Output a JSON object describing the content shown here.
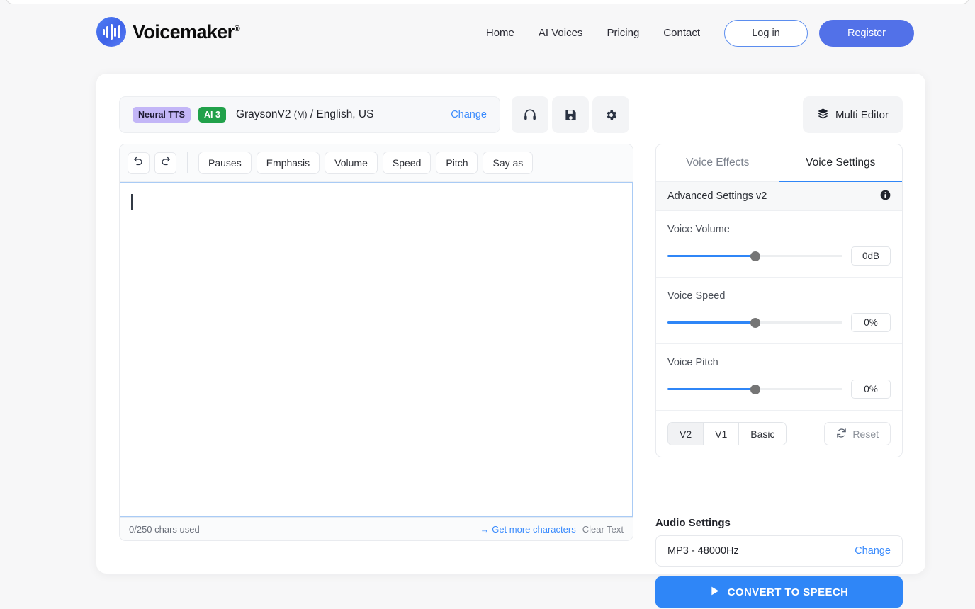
{
  "brand": {
    "name": "Voicemaker",
    "registered": "®",
    "logo_icon": "soundwave-icon"
  },
  "nav": {
    "items": [
      {
        "label": "Home"
      },
      {
        "label": "AI Voices"
      },
      {
        "label": "Pricing"
      },
      {
        "label": "Contact"
      }
    ],
    "login_label": "Log in",
    "register_label": "Register"
  },
  "voice_bar": {
    "badge_engine": "Neural TTS",
    "badge_ai": "AI 3",
    "voice_name": "GraysonV2",
    "voice_gender": "(M)",
    "voice_locale": "/ English, US",
    "change_label": "Change",
    "icons": [
      "headphones-icon",
      "save-icon",
      "gear-icon"
    ],
    "multi_editor_label": "Multi Editor",
    "multi_editor_icon": "layers-icon"
  },
  "editor": {
    "undo_icon": "undo-icon",
    "redo_icon": "redo-icon",
    "tools": [
      {
        "label": "Pauses"
      },
      {
        "label": "Emphasis"
      },
      {
        "label": "Volume"
      },
      {
        "label": "Speed"
      },
      {
        "label": "Pitch"
      },
      {
        "label": "Say as"
      }
    ],
    "text_value": "",
    "char_count": "0/250 chars used",
    "get_more_label": "Get more characters",
    "get_more_arrow": "→",
    "clear_text_label": "Clear Text"
  },
  "panel": {
    "tabs": [
      {
        "label": "Voice Effects",
        "active": false
      },
      {
        "label": "Voice Settings",
        "active": true
      }
    ],
    "advanced_label": "Advanced Settings v2",
    "info_icon": "info-icon",
    "sliders": [
      {
        "label": "Voice Volume",
        "value": "0dB",
        "percent": 50
      },
      {
        "label": "Voice Speed",
        "value": "0%",
        "percent": 50
      },
      {
        "label": "Voice Pitch",
        "value": "0%",
        "percent": 50
      }
    ],
    "segments": [
      {
        "label": "V2",
        "active": true
      },
      {
        "label": "V1",
        "active": false
      },
      {
        "label": "Basic",
        "active": false
      }
    ],
    "reset_label": "Reset",
    "reset_icon": "refresh-icon"
  },
  "audio": {
    "title": "Audio Settings",
    "format": "MP3 - 48000Hz",
    "change_label": "Change",
    "convert_label": "CONVERT TO SPEECH",
    "convert_icon": "play-icon"
  },
  "colors": {
    "accent_blue": "#2f86f7",
    "register_blue": "#5271e8",
    "badge_purple": "#c3b6f7",
    "badge_green": "#21a14a",
    "page_bg": "#f7f7f8"
  }
}
